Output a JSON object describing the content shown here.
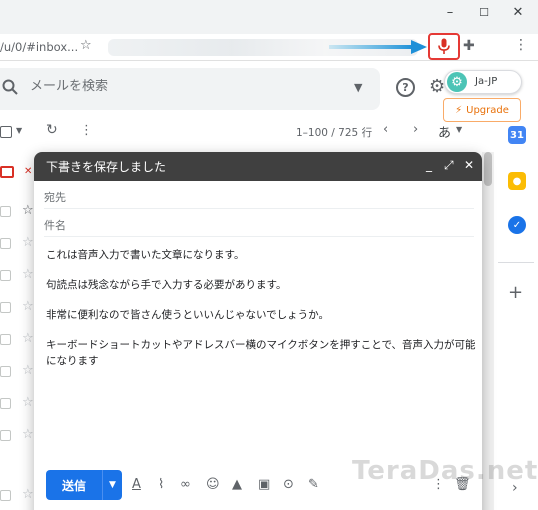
{
  "window": {
    "minimize": "–",
    "maximize": "☐",
    "close": "✕"
  },
  "address": {
    "url": "/u/0/#inbox..."
  },
  "search": {
    "placeholder": "メールを検索"
  },
  "extension": {
    "lang": "Ja-JP",
    "upgrade": "Upgrade"
  },
  "toolbar": {
    "range": "1–100 / 725 行",
    "input_tool": "あ"
  },
  "compose": {
    "title": "下書きを保存しました",
    "to_label": "宛先",
    "subject_label": "件名",
    "body": [
      "これは音声入力で書いた文章になります。",
      "句読点は残念ながら手で入力する必要があります。",
      "非常に便利なので皆さん使うといいんじゃないでしょうか。",
      "キーボードショートカットやアドレスバー横のマイクボタンを押すことで、音声入力が可能",
      "になります"
    ],
    "send_label": "送信"
  },
  "watermark": "TeraDas.net",
  "colors": {
    "accent": "#1a73e8",
    "mic_highlight": "#e53935",
    "compose_header": "#404040",
    "arrow": "#29a8e0"
  }
}
